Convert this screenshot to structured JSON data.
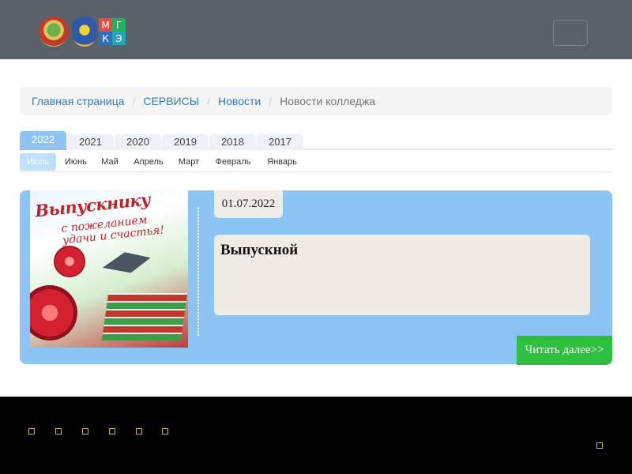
{
  "header": {
    "logo_letters": [
      "М",
      "Г",
      "К",
      "Э"
    ],
    "menu_toggle_icon": "hamburger-icon"
  },
  "breadcrumb": {
    "items": [
      "Главная страница",
      "СЕРВИСЫ",
      "Новости"
    ],
    "current": "Новости колледжа",
    "separator": "/"
  },
  "year_tabs": [
    "2022",
    "2021",
    "2020",
    "2019",
    "2018",
    "2017"
  ],
  "active_year": "2022",
  "month_tabs": [
    "Июль",
    "Июнь",
    "Май",
    "Апрель",
    "Март",
    "Февраль",
    "Январь"
  ],
  "active_month": "Июль",
  "news": {
    "date": "01.07.2022",
    "title": "Выпускной",
    "image_banner": "Выпускнику",
    "image_sub": "с пожеланием удачи и счастья!",
    "read_more": "Читать далее>>"
  },
  "footer": {
    "social_icons": [
      "social-icon-1",
      "social-icon-2",
      "social-icon-3",
      "social-icon-4",
      "social-icon-5",
      "social-icon-6"
    ]
  },
  "colors": {
    "navbar": "#5b6169",
    "card": "#8cc4f3",
    "read_more": "#2ebf3e",
    "link": "#337ab7"
  }
}
